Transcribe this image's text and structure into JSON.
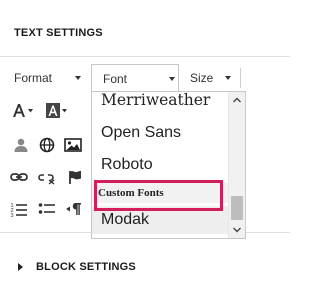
{
  "text_settings": {
    "title": "TEXT SETTINGS"
  },
  "toolbar": {
    "format_label": "Format",
    "font_label": "Font",
    "size_label": "Size"
  },
  "font_menu": {
    "items": [
      "Merriweather",
      "Open Sans",
      "Roboto"
    ],
    "custom_heading": "Custom Fonts",
    "custom_items": [
      "Modak"
    ]
  },
  "block_settings": {
    "title": "BLOCK SETTINGS"
  },
  "colors": {
    "highlight": "#d21f5a",
    "divider": "#e2e2e2"
  },
  "icons": [
    "text-color-icon",
    "background-color-icon",
    "person-icon",
    "globe-icon",
    "image-icon",
    "link-icon",
    "unlink-icon",
    "flag-icon",
    "numbered-list-icon",
    "bulleted-list-icon",
    "paragraph-direction-icon"
  ]
}
